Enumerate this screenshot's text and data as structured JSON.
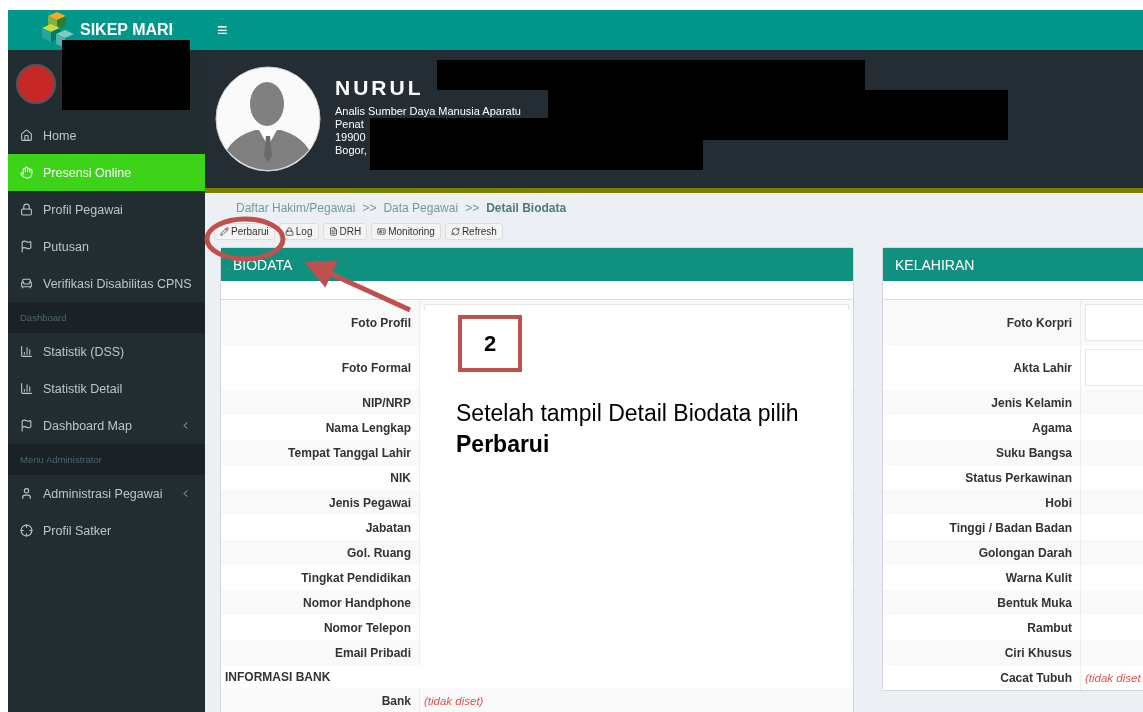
{
  "app": {
    "brand": "SIKEP MARI",
    "menu_toggle": "≡"
  },
  "sidebar": {
    "items": [
      {
        "kind": "item",
        "label": "Home",
        "selected": false,
        "submenu": false
      },
      {
        "kind": "item",
        "label": "Presensi Online",
        "selected": true,
        "submenu": false
      },
      {
        "kind": "item",
        "label": "Profil Pegawai",
        "selected": false,
        "submenu": false
      },
      {
        "kind": "item",
        "label": "Putusan",
        "selected": false,
        "submenu": false
      },
      {
        "kind": "item",
        "label": "Verifikasi Disabilitas CPNS",
        "selected": false,
        "submenu": false
      },
      {
        "kind": "header",
        "label": "Dashboard"
      },
      {
        "kind": "item",
        "label": "Statistik (DSS)",
        "selected": false,
        "submenu": false
      },
      {
        "kind": "item",
        "label": "Statistik Detail",
        "selected": false,
        "submenu": false
      },
      {
        "kind": "item",
        "label": "Dashboard Map",
        "selected": false,
        "submenu": true
      },
      {
        "kind": "header",
        "label": "Menu Administrator"
      },
      {
        "kind": "item",
        "label": "Administrasi Pegawai",
        "selected": false,
        "submenu": true
      },
      {
        "kind": "item",
        "label": "Profil Satker",
        "selected": false,
        "submenu": false
      }
    ]
  },
  "profile": {
    "name": "NURUL",
    "lines": [
      "Analis Sumber Daya Manusia Aparatu",
      "Penat",
      "19900",
      "Bogor,"
    ]
  },
  "breadcrumb": [
    {
      "kind": "link",
      "label": "Daftar Hakim/Pegawai"
    },
    {
      "kind": "separator",
      "label": ">>"
    },
    {
      "kind": "link",
      "label": "Data Pegawai"
    },
    {
      "kind": "separator",
      "label": ">>"
    },
    {
      "kind": "current",
      "label": "Detail Biodata"
    }
  ],
  "toolbar": [
    {
      "label": "Perbarui"
    },
    {
      "label": "Log"
    },
    {
      "label": "DRH"
    },
    {
      "label": "Monitoring"
    },
    {
      "label": "Refresh"
    }
  ],
  "panels": [
    {
      "title": "BIODATA",
      "rows": [
        {
          "kind": "photo",
          "label": "Foto Profil"
        },
        {
          "kind": "photo",
          "label": "Foto Formal"
        },
        {
          "kind": "field",
          "label": "NIP/NRP"
        },
        {
          "kind": "field",
          "label": "Nama Lengkap"
        },
        {
          "kind": "field",
          "label": "Tempat Tanggal Lahir"
        },
        {
          "kind": "field",
          "label": "NIK"
        },
        {
          "kind": "field",
          "label": "Jenis Pegawai"
        },
        {
          "kind": "field",
          "label": "Jabatan"
        },
        {
          "kind": "field",
          "label": "Gol. Ruang"
        },
        {
          "kind": "field",
          "label": "Tingkat Pendidikan"
        },
        {
          "kind": "field",
          "label": "Nomor Handphone"
        },
        {
          "kind": "field",
          "label": "Nomor Telepon"
        },
        {
          "kind": "field",
          "label": "Email Pribadi"
        },
        {
          "kind": "section",
          "label": "INFORMASI BANK"
        },
        {
          "kind": "field",
          "label": "Bank",
          "value": "(tidak diset)",
          "unset": true
        }
      ]
    },
    {
      "title": "KELAHIRAN",
      "rows": [
        {
          "kind": "photo",
          "label": "Foto Korpri"
        },
        {
          "kind": "photo",
          "label": "Akta Lahir"
        },
        {
          "kind": "field",
          "label": "Jenis Kelamin"
        },
        {
          "kind": "field",
          "label": "Agama"
        },
        {
          "kind": "field",
          "label": "Suku Bangsa"
        },
        {
          "kind": "field",
          "label": "Status Perkawinan"
        },
        {
          "kind": "field",
          "label": "Hobi"
        },
        {
          "kind": "field",
          "label": "Tinggi / Badan Badan"
        },
        {
          "kind": "field",
          "label": "Golongan Darah"
        },
        {
          "kind": "field",
          "label": "Warna Kulit"
        },
        {
          "kind": "field",
          "label": "Bentuk Muka"
        },
        {
          "kind": "field",
          "label": "Rambut"
        },
        {
          "kind": "field",
          "label": "Ciri Khusus"
        },
        {
          "kind": "field",
          "label": "Cacat Tubuh",
          "value": "(tidak diset",
          "unset": true
        }
      ]
    }
  ],
  "annotation": {
    "step": "2",
    "text": "Setelah tampil Detail Biodata pilih **Perbarui**"
  }
}
